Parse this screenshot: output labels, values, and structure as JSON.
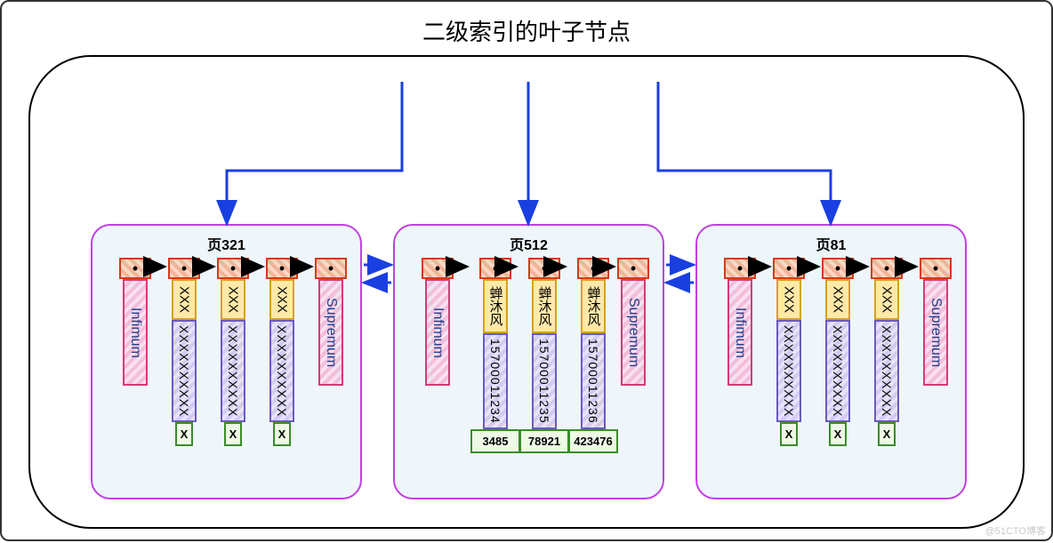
{
  "title": "二级索引的叶子节点",
  "labels": {
    "infimum": "Infimum",
    "supremum": "Supremum",
    "xxx": "XXX",
    "xseq": "XXXXXXXXXX",
    "pk_x": "X",
    "name_cn": "蝉沐风"
  },
  "pages": [
    {
      "title": "页321",
      "records": [
        {
          "type": "sentinel",
          "label": "Infimum"
        },
        {
          "type": "data",
          "key": "XXX",
          "col": "XXXXXXXXXX",
          "pk": "X"
        },
        {
          "type": "data",
          "key": "XXX",
          "col": "XXXXXXXXXX",
          "pk": "X"
        },
        {
          "type": "data",
          "key": "XXX",
          "col": "XXXXXXXXXX",
          "pk": "X"
        },
        {
          "type": "sentinel",
          "label": "Supremum"
        }
      ]
    },
    {
      "title": "页512",
      "records": [
        {
          "type": "sentinel",
          "label": "Infimum"
        },
        {
          "type": "data",
          "key": "蝉沐风",
          "col": "15700011234",
          "pk": "3485"
        },
        {
          "type": "data",
          "key": "蝉沐风",
          "col": "15700011235",
          "pk": "78921"
        },
        {
          "type": "data",
          "key": "蝉沐风",
          "col": "15700011236",
          "pk": "423476"
        },
        {
          "type": "sentinel",
          "label": "Supremum"
        }
      ]
    },
    {
      "title": "页81",
      "records": [
        {
          "type": "sentinel",
          "label": "Infimum"
        },
        {
          "type": "data",
          "key": "XXX",
          "col": "XXXXXXXXXX",
          "pk": "X"
        },
        {
          "type": "data",
          "key": "XXX",
          "col": "XXXXXXXXXX",
          "pk": "X"
        },
        {
          "type": "data",
          "key": "XXX",
          "col": "XXXXXXXXXX",
          "pk": "X"
        },
        {
          "type": "sentinel",
          "label": "Supremum"
        }
      ]
    }
  ],
  "watermark": "@51CTO博客"
}
